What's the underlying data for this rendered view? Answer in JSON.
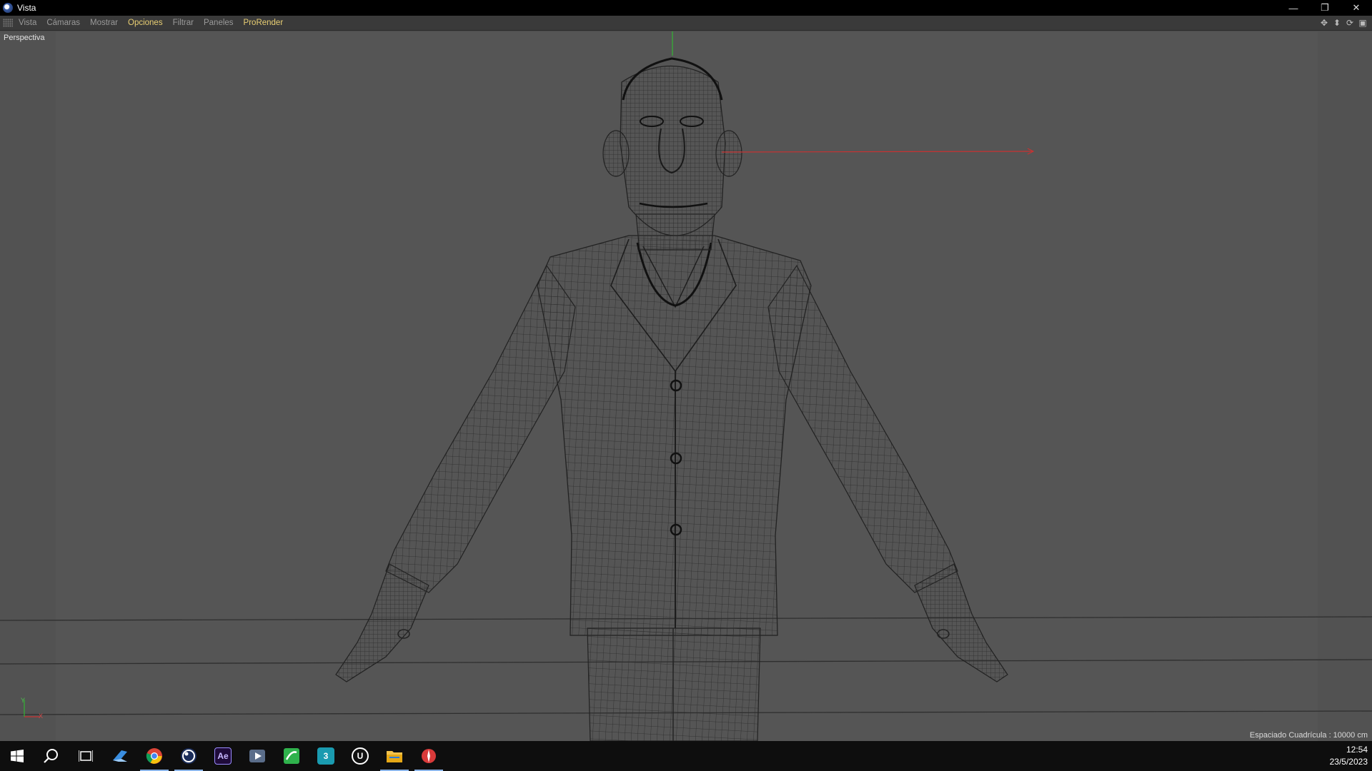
{
  "window": {
    "title": "Vista",
    "minimize_glyph": "—",
    "restore_glyph": "❐",
    "close_glyph": "✕"
  },
  "menu": {
    "items": [
      {
        "label": "Vista",
        "highlight": false
      },
      {
        "label": "Cámaras",
        "highlight": false
      },
      {
        "label": "Mostrar",
        "highlight": false
      },
      {
        "label": "Opciones",
        "highlight": true
      },
      {
        "label": "Filtrar",
        "highlight": false
      },
      {
        "label": "Paneles",
        "highlight": false
      },
      {
        "label": "ProRender",
        "highlight": true
      }
    ],
    "highlight_color": "#e9cf73",
    "tool_icons": [
      "move-view-icon",
      "dolly-view-icon",
      "rotate-view-icon",
      "toggle-view-icon"
    ]
  },
  "viewport": {
    "label": "Perspectiva",
    "grid_spacing": "Espaciado Cuadrícula : 10000 cm",
    "axis": {
      "y": "Y",
      "x": "X"
    },
    "colors": {
      "wire": "#222222",
      "x_axis": "#c83232",
      "y_axis": "#32b432",
      "bg": "#555555"
    }
  },
  "taskbar": {
    "icons": [
      {
        "name": "windows-start-icon",
        "active": false
      },
      {
        "name": "search-icon",
        "active": false
      },
      {
        "name": "task-view-icon",
        "active": false
      },
      {
        "name": "fusion-app-icon",
        "active": false
      },
      {
        "name": "chrome-icon",
        "active": true
      },
      {
        "name": "cinema4d-icon",
        "active": true
      },
      {
        "name": "after-effects-icon",
        "active": false,
        "text": "Ae"
      },
      {
        "name": "media-player-icon",
        "active": false
      },
      {
        "name": "green-app-icon",
        "active": false
      },
      {
        "name": "3dsmax-icon",
        "active": false,
        "text": "3"
      },
      {
        "name": "unreal-engine-icon",
        "active": false,
        "text": "U"
      },
      {
        "name": "file-explorer-icon",
        "active": true
      },
      {
        "name": "paint-app-icon",
        "active": true
      }
    ],
    "time": "12:54",
    "date": "23/5/2023"
  }
}
